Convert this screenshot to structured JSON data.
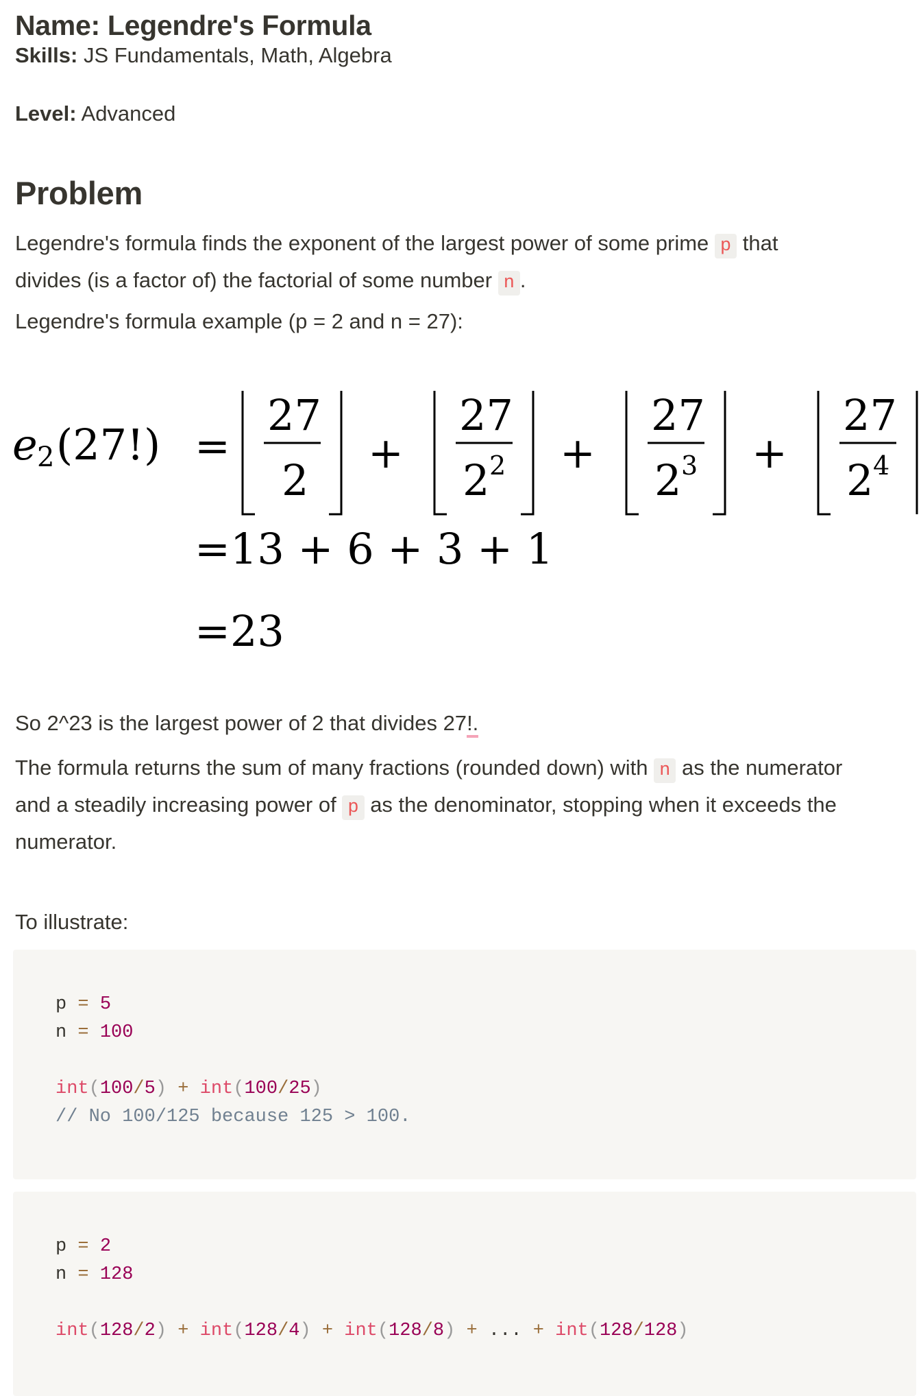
{
  "title": "Name: Legendre's Formula",
  "skills": {
    "label": "Skills:",
    "value": "JS Fundamentals, Math, Algebra"
  },
  "level": {
    "label": "Level:",
    "value": "Advanced"
  },
  "problem": {
    "heading": "Problem",
    "p1_a": "Legendre's formula finds the exponent of the largest power of some prime",
    "p1_code": "p",
    "p1_b": "that",
    "p1_c": "divides (is a factor of) the factorial of some number",
    "p1_code2": "n",
    "p1_d": ".",
    "p2": "Legendre's formula example (p = 2 and n = 27):",
    "p3_a": "So 2^23 is the largest power of 2 that divides 27",
    "p3_b": "!.",
    "p4_a": "The formula returns the sum of many fractions (rounded down) with",
    "p4_code": "n",
    "p4_b": "as the numerator",
    "p4_c": "and a steadily increasing power of",
    "p4_code2": "p",
    "p4_d": "as the denominator, stopping when it exceeds the",
    "p4_e": "numerator.",
    "p5": "To illustrate:"
  },
  "formula": {
    "lhs_e": "e",
    "lhs_sub": "2",
    "lhs_arg": "(27!)",
    "eq": "=",
    "plus": "+",
    "fractions": [
      {
        "num": "27",
        "den": "2",
        "exp": ""
      },
      {
        "num": "27",
        "den": "2",
        "exp": "2"
      },
      {
        "num": "27",
        "den": "2",
        "exp": "3"
      },
      {
        "num": "27",
        "den": "2",
        "exp": "4"
      }
    ],
    "line2": "=13 + 6 + 3 + 1",
    "line3": "=23"
  },
  "code1": {
    "p_var": "p",
    "p_val": "5",
    "n_var": "n",
    "n_val": "100",
    "fn": "int",
    "a1": "100",
    "a2": "5",
    "b1": "100",
    "b2": "25",
    "comment": "// No 100/125 because 125 > 100."
  },
  "code2": {
    "p_var": "p",
    "p_val": "2",
    "n_var": "n",
    "n_val": "128",
    "fn": "int",
    "a1": "128",
    "a2": "2",
    "b1": "128",
    "b2": "4",
    "c1": "128",
    "c2": "8",
    "ellipsis": "...",
    "d1": "128",
    "d2": "128"
  },
  "colors": {
    "text": "#37352f",
    "inline_code": "#eb5757",
    "code_bg": "#f7f6f3",
    "number": "#990055",
    "function": "#dd4a68",
    "operator": "#9a6e3a",
    "comment": "#708090"
  }
}
